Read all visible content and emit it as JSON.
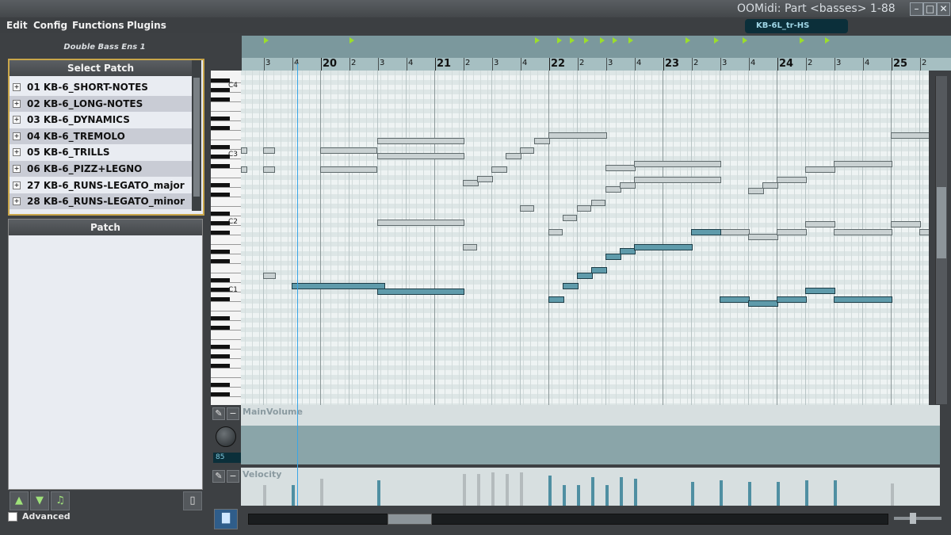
{
  "window": {
    "title": "OOMidi: Part <basses> 1-88",
    "minimize": "–",
    "maximize": "□",
    "close": "✕"
  },
  "menu": [
    "Edit",
    "Config",
    "Functions",
    "Plugins"
  ],
  "instrument_name": "Double Bass Ens 1",
  "select_patch": {
    "header": "Select Patch",
    "items": [
      "01 KB-6_SHORT-NOTES",
      "02 KB-6_LONG-NOTES",
      "03 KB-6_DYNAMICS",
      "04 KB-6_TREMOLO",
      "05 KB-6_TRILLS",
      "06 KB-6_PIZZ+LEGNO",
      "27 KB-6_RUNS-LEGATO_major",
      "28 KB-6_RUNS-LEGATO_minor"
    ]
  },
  "patch_panel": {
    "header": "Patch"
  },
  "advanced_label": "Advanced",
  "track_name": "KB-6L_tr-HS",
  "ruler": {
    "bars": [
      "20",
      "21",
      "22",
      "23",
      "24",
      "25"
    ],
    "beats": [
      "3",
      "4",
      "2",
      "3",
      "4",
      "2",
      "3",
      "4",
      "2",
      "3",
      "4",
      "2",
      "3",
      "4",
      "2",
      "3",
      "4",
      "2",
      "3",
      "4",
      "2",
      "3"
    ]
  },
  "key_labels": [
    "C4",
    "C3",
    "C2",
    "C1"
  ],
  "lanes": {
    "volume_label": "MainVolume",
    "volume_value": "85",
    "velocity_label": "Velocity"
  },
  "colors": {
    "selected_note": "#5f9bab",
    "note": "#c9d1d2",
    "accent": "#c9a64a",
    "playhead": "#3aa6e6"
  },
  "icons": [
    "wrench-icon",
    "minus-icon",
    "volume-knob-icon",
    "up-arrow-icon",
    "down-arrow-icon",
    "note-icon",
    "trash-icon",
    "bar-chart-icon"
  ]
}
